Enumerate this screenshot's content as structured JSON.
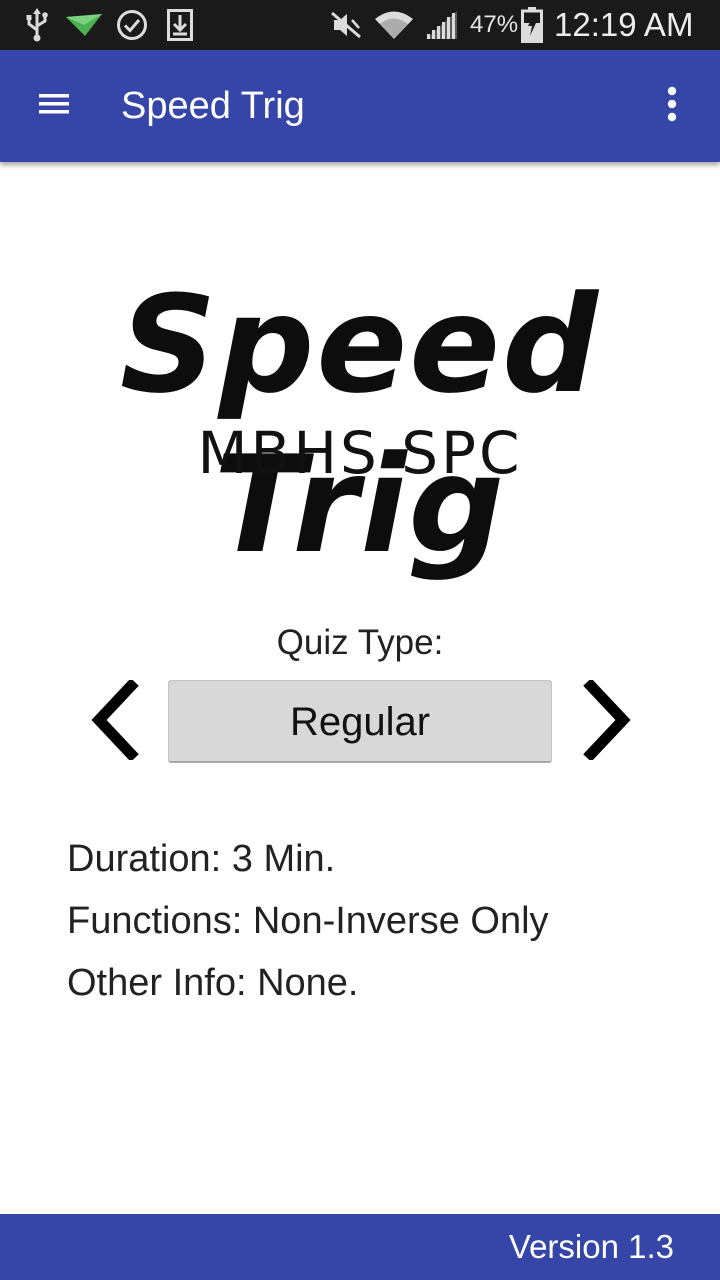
{
  "status_bar": {
    "battery_percent": "47%",
    "time": "12:19 AM",
    "icons": [
      "usb-icon",
      "notification-flag-icon",
      "check-circle-icon",
      "download-icon",
      "mute-icon",
      "wifi-icon",
      "signal-icon",
      "battery-icon"
    ]
  },
  "app_bar": {
    "title": "Speed Trig",
    "menu_icon": "hamburger-menu-icon",
    "overflow_icon": "more-vert-icon",
    "color": "#3646a8"
  },
  "logo": {
    "title": "Speed Trig",
    "subtitle": "MBHS SPC"
  },
  "quiz": {
    "label": "Quiz Type:",
    "selected_type": "Regular",
    "prev_icon": "chevron-left-icon",
    "next_icon": "chevron-right-icon"
  },
  "details": {
    "duration": "Duration: 3 Min.",
    "functions": "Functions: Non-Inverse Only",
    "other_info": "Other Info: None."
  },
  "footer": {
    "version": "Version 1.3"
  }
}
